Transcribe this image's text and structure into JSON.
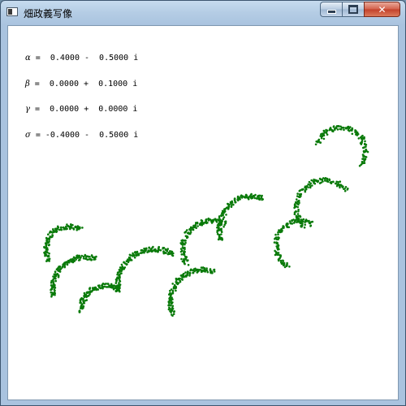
{
  "window": {
    "title": "畑政義写像",
    "buttons": {
      "minimize": "",
      "maximize": "",
      "close": "✕"
    }
  },
  "parameters": [
    {
      "symbol": "α",
      "text": " =  0.4000 -  0.5000 i"
    },
    {
      "symbol": "β",
      "text": " =  0.0000 +  0.1000 i"
    },
    {
      "symbol": "γ",
      "text": " =  0.0000 +  0.0000 i"
    },
    {
      "symbol": "σ",
      "text": " = -0.4000 -  0.5000 i"
    }
  ],
  "colors": {
    "fractal": "#0a7a0a"
  }
}
